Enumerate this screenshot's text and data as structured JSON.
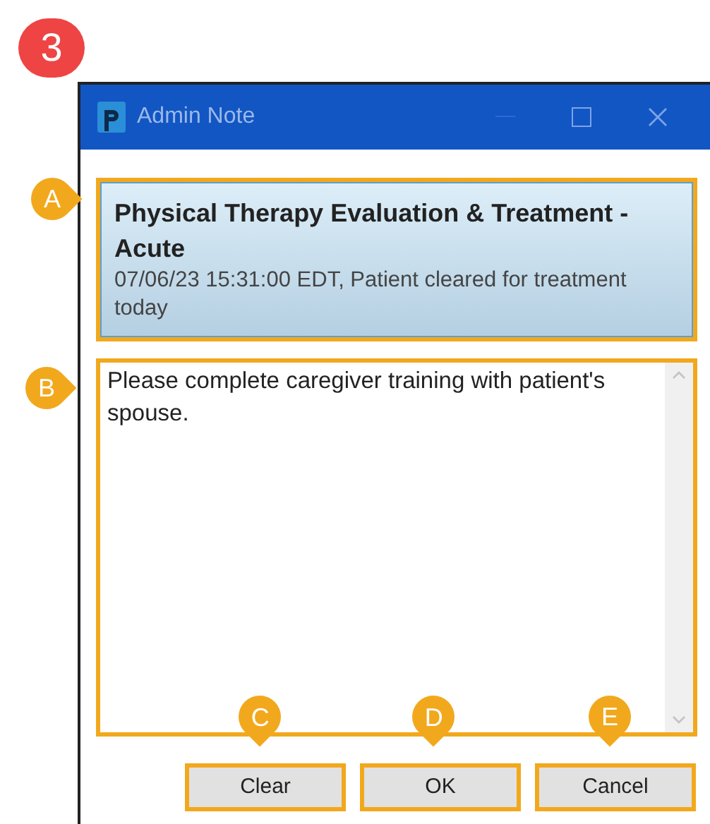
{
  "step_badge": "3",
  "window": {
    "title": "Admin Note"
  },
  "header": {
    "title": "Physical Therapy Evaluation & Treatment - Acute",
    "subtitle": "07/06/23 15:31:00 EDT, Patient cleared for treatment today"
  },
  "note": {
    "value": "Please complete caregiver training with patient's spouse."
  },
  "buttons": [
    "Clear",
    "OK",
    "Cancel"
  ],
  "callouts": [
    {
      "label": "A",
      "kind": "right"
    },
    {
      "label": "B",
      "kind": "right"
    },
    {
      "label": "C",
      "kind": "down"
    },
    {
      "label": "D",
      "kind": "down"
    },
    {
      "label": "E",
      "kind": "down"
    }
  ]
}
